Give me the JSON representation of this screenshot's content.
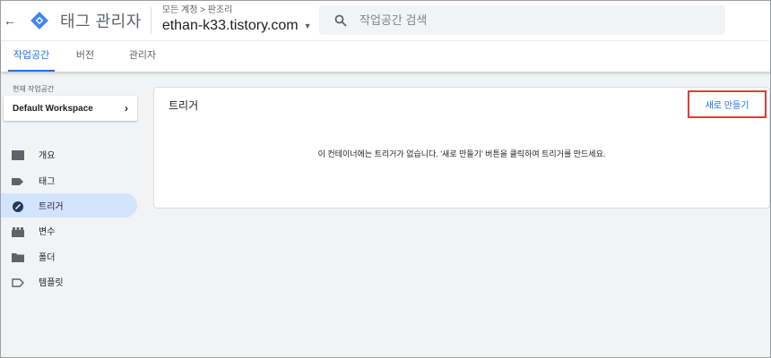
{
  "header": {
    "back_icon": "arrow-back-icon",
    "app_title": "태그 관리자",
    "account_path": "모든 계정 > 판조리",
    "container_name": "ethan-k33.tistory.com",
    "brand_color": "#4285f4",
    "search": {
      "placeholder": "작업공간 검색",
      "value": ""
    }
  },
  "tabs": [
    {
      "label": "작업공간",
      "active": true
    },
    {
      "label": "버전",
      "active": false
    },
    {
      "label": "관리자",
      "active": false
    }
  ],
  "sidebar": {
    "workspace_label": "현재 작업공간",
    "workspace_name": "Default Workspace",
    "items": [
      {
        "label": "개요",
        "icon": "overview-icon",
        "active": false
      },
      {
        "label": "태그",
        "icon": "tag-icon",
        "active": false
      },
      {
        "label": "트리거",
        "icon": "trigger-icon",
        "active": true
      },
      {
        "label": "변수",
        "icon": "variables-icon",
        "active": false
      },
      {
        "label": "폴더",
        "icon": "folder-icon",
        "active": false
      },
      {
        "label": "템플릿",
        "icon": "template-icon",
        "active": false
      }
    ]
  },
  "main": {
    "title": "트리거",
    "new_button_label": "새로 만들기",
    "empty_message": "이 컨테이너에는 트리거가 없습니다. '새로 만들기' 버튼을 클릭하여 트리거를 만드세요.",
    "highlight_color": "#e53935",
    "accent_color": "#1a73e8"
  }
}
